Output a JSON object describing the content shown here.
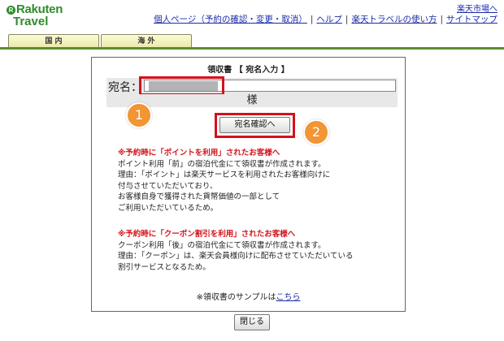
{
  "brand": {
    "mark": "R",
    "line1": "Rakuten",
    "line2": "Travel"
  },
  "header": {
    "top_right_link": "楽天市場へ",
    "links": [
      "個人ページ（予約の確認・変更・取消）",
      "ヘルプ",
      "楽天トラベルの使い方",
      "サイトマップ"
    ]
  },
  "tabs": [
    "国 内",
    "海 外"
  ],
  "dialog": {
    "title": "領収書 【 宛名入力 】",
    "name_label": "宛名：",
    "name_value": "",
    "honorific": "様",
    "confirm_button": "宛名確認へ",
    "callouts": [
      "1",
      "2"
    ],
    "notice_points": {
      "heading": "※予約時に「ポイントを利用」されたお客様へ",
      "lines": [
        "ポイント利用「前」の宿泊代金にて領収書が作成されます。",
        "理由：「ポイント」は楽天サービスを利用されたお客様向けに",
        "付与させていただいており、",
        "お客様自身で獲得された貨幣価値の一部として",
        "ご利用いただいているため。"
      ]
    },
    "notice_coupon": {
      "heading": "※予約時に「クーポン割引を利用」されたお客様へ",
      "lines": [
        "クーポン利用「後」の宿泊代金にて領収書が作成されます。",
        "理由：「クーポン」は、楽天会員様向けに配布させていただいている",
        "割引サービスとなるため。"
      ]
    },
    "sample_text": "※領収書のサンプルは",
    "sample_link": "こちら"
  },
  "footer": {
    "close_button": "閉じる"
  },
  "colors": {
    "brand_green": "#2e8c2a",
    "link_blue": "#1a2aa8",
    "alert_red": "#d4141d",
    "callout_orange": "#f19535"
  }
}
